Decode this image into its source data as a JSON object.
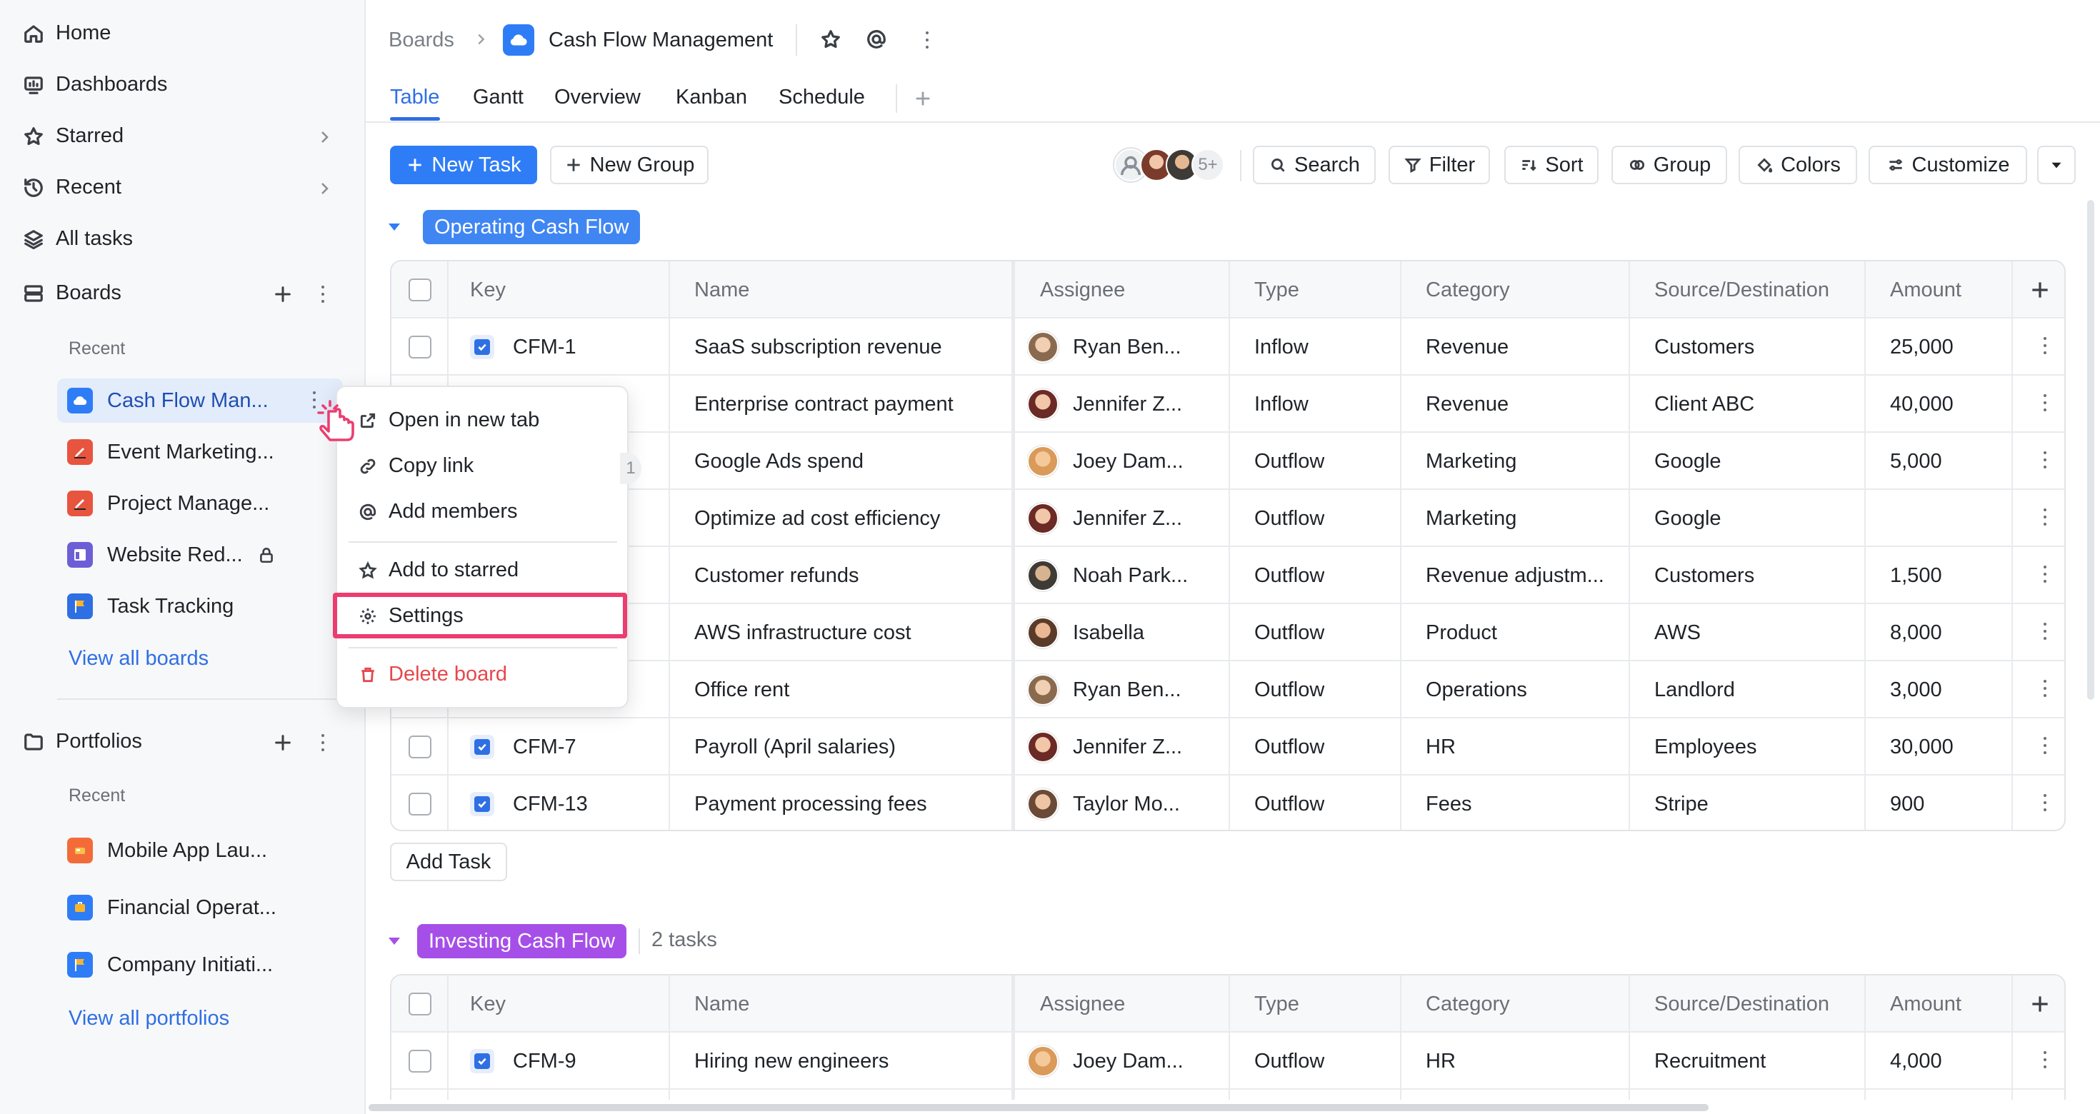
{
  "sidebar": {
    "nav": [
      {
        "label": "Home",
        "icon": "home-icon"
      },
      {
        "label": "Dashboards",
        "icon": "dashboard-icon"
      },
      {
        "label": "Starred",
        "icon": "star-icon"
      },
      {
        "label": "Recent",
        "icon": "history-icon"
      },
      {
        "label": "All tasks",
        "icon": "layers-icon"
      }
    ],
    "boards": {
      "title": "Boards",
      "recent_label": "Recent",
      "items": [
        {
          "label": "Cash Flow Man...",
          "color": "#2f7df6"
        },
        {
          "label": "Event Marketing...",
          "color": "#e8553e"
        },
        {
          "label": "Project Manage...",
          "color": "#e8553e"
        },
        {
          "label": "Website Red...",
          "color": "#6c5fd6"
        },
        {
          "label": "Task Tracking",
          "color": "#2f6fe4"
        }
      ],
      "view_all": "View all boards"
    },
    "portfolios": {
      "title": "Portfolios",
      "recent_label": "Recent",
      "items": [
        {
          "label": "Mobile App Lau...",
          "color": "#f46b3a"
        },
        {
          "label": "Financial Operat...",
          "color": "#2f7df6"
        },
        {
          "label": "Company Initiati...",
          "color": "#2f7df6"
        }
      ],
      "view_all": "View all portfolios"
    }
  },
  "header": {
    "breadcrumb_root": "Boards",
    "board_title": "Cash Flow Management",
    "tabs": [
      "Table",
      "Gantt",
      "Overview",
      "Kanban",
      "Schedule"
    ],
    "active_tab": "Table"
  },
  "toolbar": {
    "new_task": "New Task",
    "new_group": "New Group",
    "members_more": "5+",
    "search": "Search",
    "filter": "Filter",
    "sort": "Sort",
    "group": "Group",
    "colors": "Colors",
    "customize": "Customize"
  },
  "columns": [
    "Key",
    "Name",
    "Assignee",
    "Type",
    "Category",
    "Source/Destination",
    "Amount"
  ],
  "groups": [
    {
      "name": "Operating Cash Flow",
      "color": "#3f86f3",
      "rows": [
        {
          "key": "CFM-1",
          "name": "SaaS subscription revenue",
          "assignee": "Ryan Ben...",
          "type": "Inflow",
          "category": "Revenue",
          "source": "Customers",
          "amount": "25,000"
        },
        {
          "key": "",
          "name": "Enterprise contract payment",
          "assignee": "Jennifer Z...",
          "type": "Inflow",
          "category": "Revenue",
          "source": "Client ABC",
          "amount": "40,000"
        },
        {
          "key": "",
          "name": "Google Ads spend",
          "assignee": "Joey Dam...",
          "type": "Outflow",
          "category": "Marketing",
          "source": "Google",
          "amount": "5,000"
        },
        {
          "key": "",
          "name": "Optimize ad cost efficiency",
          "assignee": "Jennifer Z...",
          "type": "Outflow",
          "category": "Marketing",
          "source": "Google",
          "amount": ""
        },
        {
          "key": "",
          "name": "Customer refunds",
          "assignee": "Noah Park...",
          "type": "Outflow",
          "category": "Revenue adjustm...",
          "source": "Customers",
          "amount": "1,500"
        },
        {
          "key": "",
          "name": "AWS infrastructure cost",
          "assignee": "Isabella",
          "type": "Outflow",
          "category": "Product",
          "source": "AWS",
          "amount": "8,000"
        },
        {
          "key": "",
          "name": "Office rent",
          "assignee": "Ryan Ben...",
          "type": "Outflow",
          "category": "Operations",
          "source": "Landlord",
          "amount": "3,000"
        },
        {
          "key": "CFM-7",
          "name": "Payroll (April salaries)",
          "assignee": "Jennifer Z...",
          "type": "Outflow",
          "category": "HR",
          "source": "Employees",
          "amount": "30,000"
        },
        {
          "key": "CFM-13",
          "name": "Payment processing fees",
          "assignee": "Taylor Mo...",
          "type": "Outflow",
          "category": "Fees",
          "source": "Stripe",
          "amount": "900"
        }
      ],
      "add_task": "Add Task"
    },
    {
      "name": "Investing Cash Flow",
      "color": "#a64fe8",
      "count": "2 tasks",
      "rows": [
        {
          "key": "CFM-9",
          "name": "Hiring new engineers",
          "assignee": "Joey Dam...",
          "type": "Outflow",
          "category": "HR",
          "source": "Recruitment",
          "amount": "4,000"
        }
      ]
    }
  ],
  "context_menu": {
    "items": [
      "Open in new tab",
      "Copy link",
      "Add members",
      "Add to starred",
      "Settings",
      "Delete board"
    ],
    "highlight": "Settings",
    "partial_badge": "1"
  }
}
